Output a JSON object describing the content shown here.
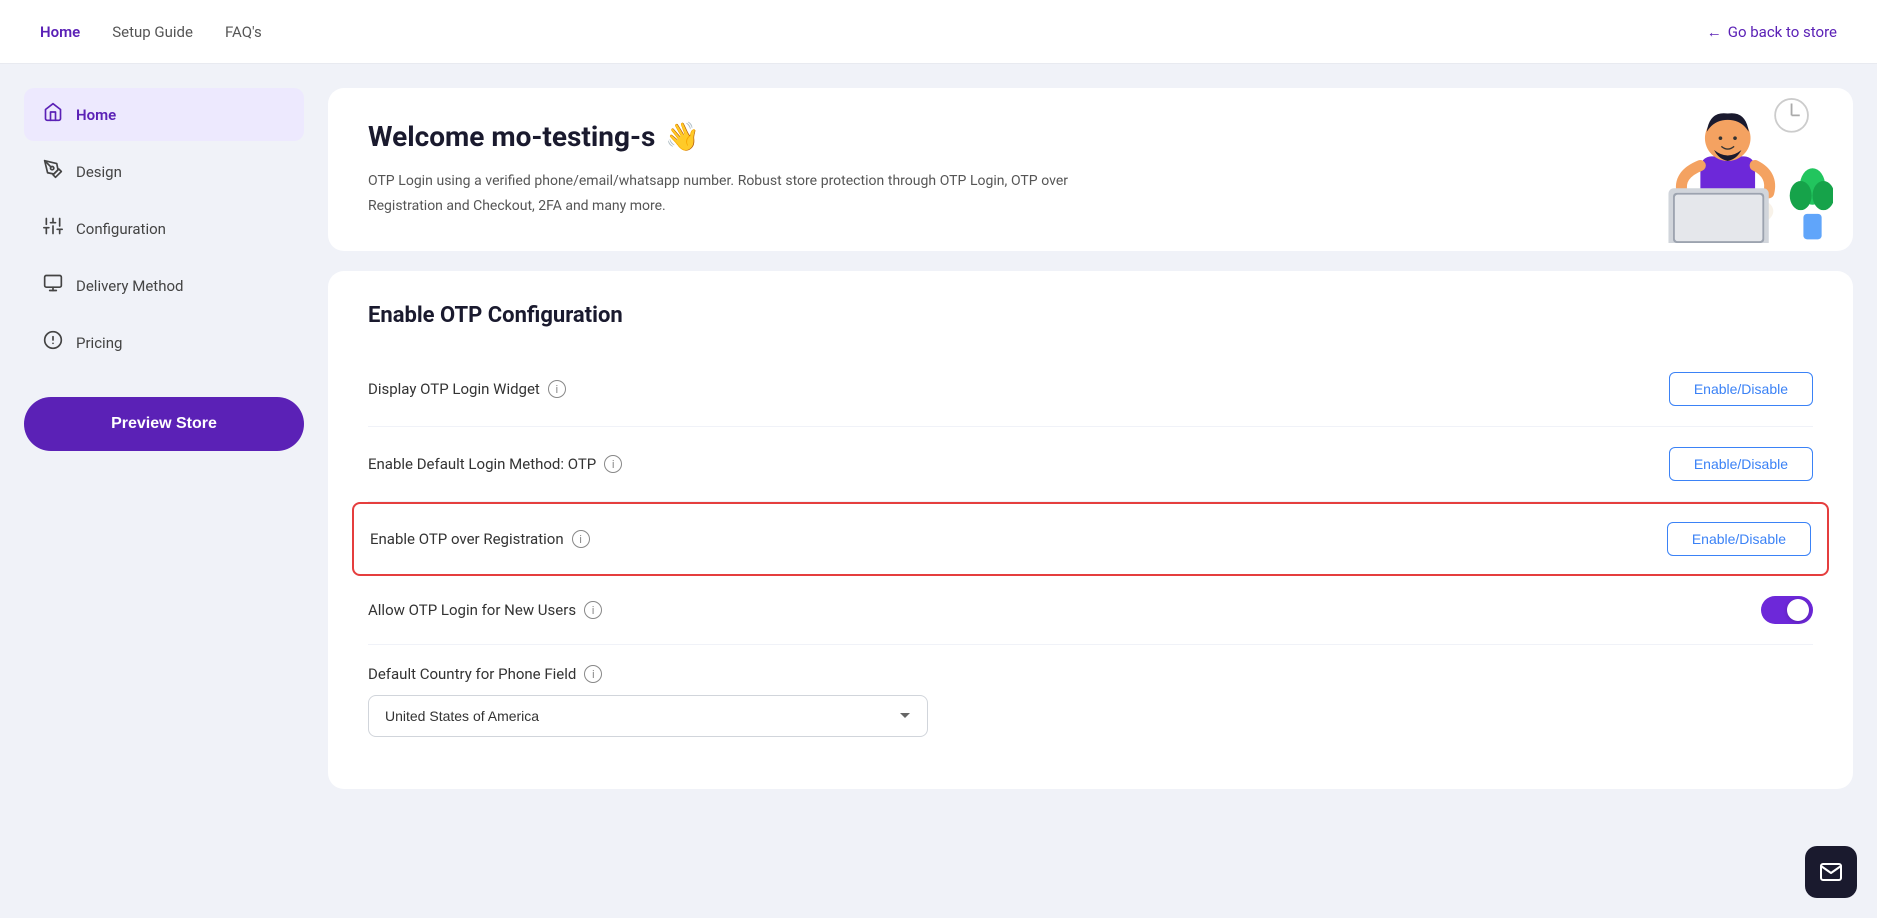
{
  "nav": {
    "links": [
      {
        "label": "Home",
        "active": true
      },
      {
        "label": "Setup Guide",
        "active": false
      },
      {
        "label": "FAQ's",
        "active": false
      }
    ],
    "go_back_label": "Go back to store"
  },
  "sidebar": {
    "items": [
      {
        "label": "Home",
        "icon": "🏠",
        "active": true
      },
      {
        "label": "Design",
        "icon": "🖊",
        "active": false
      },
      {
        "label": "Configuration",
        "icon": "⚙",
        "active": false
      },
      {
        "label": "Delivery Method",
        "icon": "📋",
        "active": false
      },
      {
        "label": "Pricing",
        "icon": "💰",
        "active": false
      }
    ],
    "preview_button": "Preview Store"
  },
  "welcome": {
    "title": "Welcome mo-testing-s",
    "wave_emoji": "👋",
    "description": "OTP Login using a verified phone/email/whatsapp number. Robust store protection through OTP Login, OTP over Registration and Checkout, 2FA and many more."
  },
  "config": {
    "section_title": "Enable OTP Configuration",
    "rows": [
      {
        "label": "Display OTP Login Widget",
        "type": "button",
        "button_label": "Enable/Disable",
        "highlighted": false
      },
      {
        "label": "Enable Default Login Method: OTP",
        "type": "button",
        "button_label": "Enable/Disable",
        "highlighted": false
      },
      {
        "label": "Enable OTP over Registration",
        "type": "button",
        "button_label": "Enable/Disable",
        "highlighted": true
      },
      {
        "label": "Allow OTP Login for New Users",
        "type": "toggle",
        "toggle_on": true,
        "highlighted": false
      },
      {
        "label": "Default Country for Phone Field",
        "type": "select",
        "select_value": "United States of America",
        "highlighted": false
      }
    ]
  },
  "colors": {
    "accent": "#5b21b6",
    "highlight_border": "#e53e3e",
    "btn_border": "#3b82f6"
  }
}
